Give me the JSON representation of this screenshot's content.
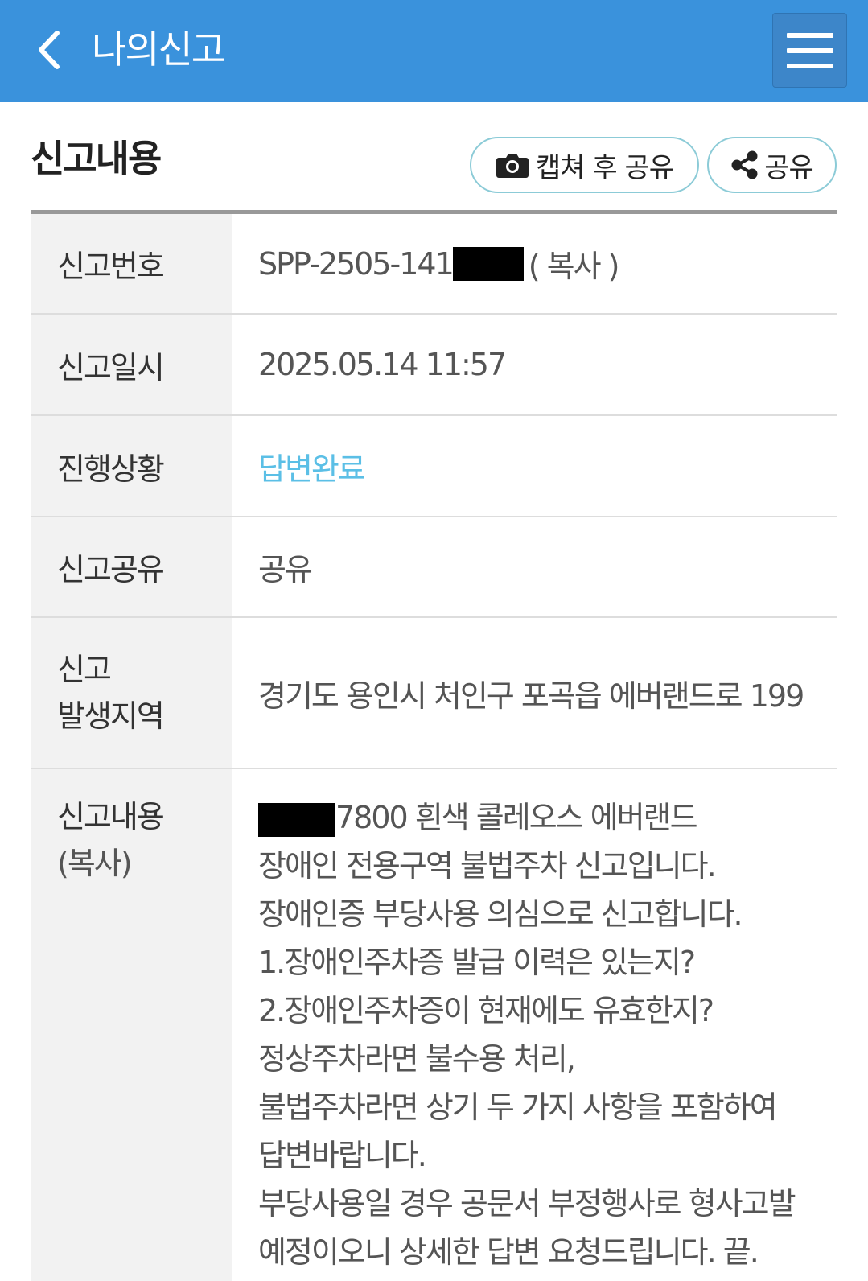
{
  "header": {
    "back_icon": "chevron-left-icon",
    "title": "나의신고",
    "menu_icon": "hamburger-menu-icon",
    "bg_color": "#3a92dc"
  },
  "section": {
    "title": "신고내용",
    "capture_share_label": "캡쳐 후 공유",
    "capture_icon": "camera-icon",
    "share_label": "공유",
    "share_icon": "share-icon"
  },
  "details": {
    "report_number": {
      "label": "신고번호",
      "value_prefix": "SPP-2505-141",
      "copy_label": "( 복사 )"
    },
    "report_date": {
      "label": "신고일시",
      "value": "2025.05.14 11:57"
    },
    "status": {
      "label": "진행상황",
      "value": "답변완료",
      "color": "#5bbfe6"
    },
    "sharing": {
      "label": "신고공유",
      "value": "공유"
    },
    "location": {
      "label_line1": "신고",
      "label_line2": "발생지역",
      "value": "경기도 용인시 처인구 포곡읍 에버랜드로 199"
    },
    "content": {
      "label_line1": "신고내용",
      "label_line2": "(복사)",
      "first_line_suffix": "7800 흰색 콜레오스 에버랜드",
      "lines": [
        "장애인 전용구역 불법주차 신고입니다.",
        "장애인증 부당사용 의심으로 신고합니다.",
        "1.장애인주차증 발급 이력은 있는지?",
        "2.장애인주차증이 현재에도 유효한지?",
        "정상주차라면 불수용 처리,",
        "불법주차라면 상기 두 가지 사항을 포함하여",
        "답변바랍니다.",
        "부당사용일 경우 공문서 부정행사로 형사고발",
        "예정이오니 상세한 답변 요청드립니다. 끝."
      ]
    }
  }
}
